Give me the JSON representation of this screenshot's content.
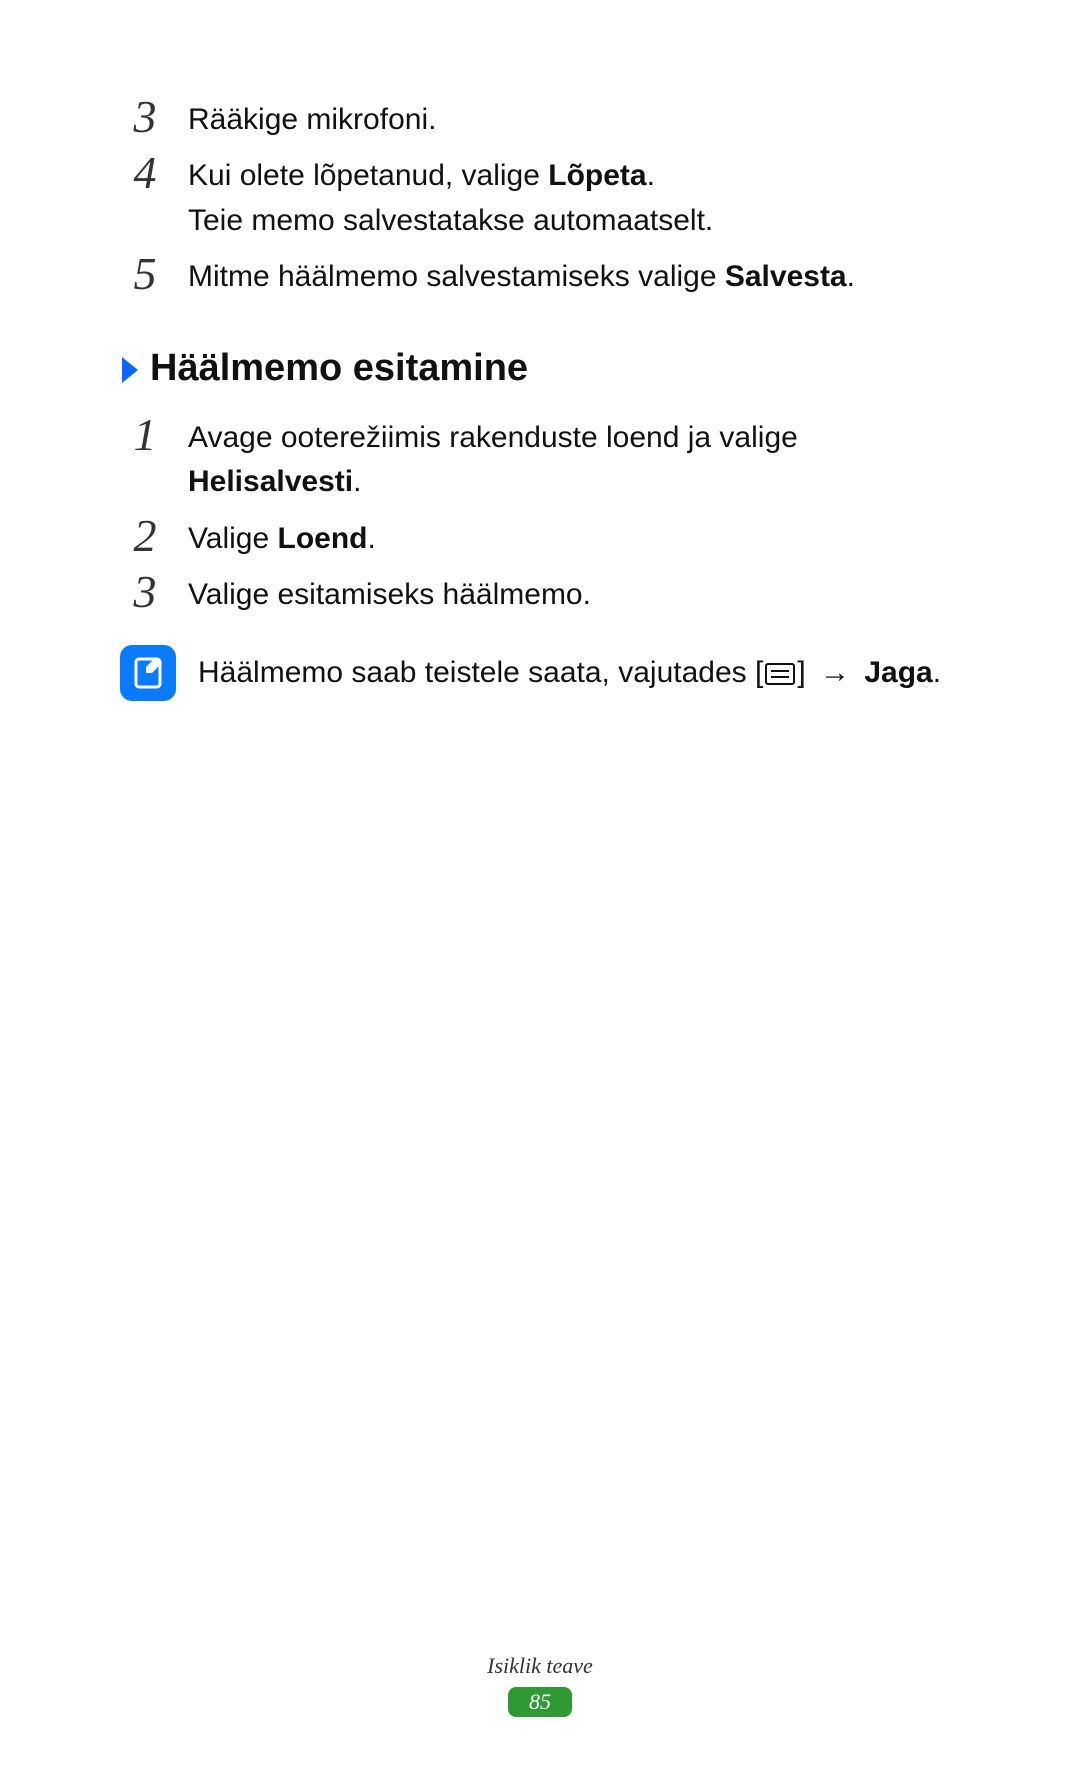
{
  "steps_a": [
    {
      "num": "3",
      "body": [
        {
          "text": "Rääkige mikrofoni."
        }
      ]
    },
    {
      "num": "4",
      "body": [
        {
          "text": "Kui olete lõpetanud, valige "
        },
        {
          "text": "Lõpeta",
          "bold": true
        },
        {
          "text": "."
        },
        {
          "break": true
        },
        {
          "text": "Teie memo salvestatakse automaatselt."
        }
      ]
    },
    {
      "num": "5",
      "body": [
        {
          "text": "Mitme häälmemo salvestamiseks valige "
        },
        {
          "text": "Salvesta",
          "bold": true
        },
        {
          "text": "."
        }
      ]
    }
  ],
  "section": {
    "title": "Häälmemo esitamine"
  },
  "steps_b": [
    {
      "num": "1",
      "body": [
        {
          "text": "Avage ooterežiimis rakenduste loend ja valige "
        },
        {
          "text": "Helisalvesti",
          "bold": true
        },
        {
          "text": "."
        }
      ]
    },
    {
      "num": "2",
      "body": [
        {
          "text": "Valige "
        },
        {
          "text": "Loend",
          "bold": true
        },
        {
          "text": "."
        }
      ]
    },
    {
      "num": "3",
      "body": [
        {
          "text": "Valige esitamiseks häälmemo."
        }
      ]
    }
  ],
  "note": {
    "parts": [
      {
        "text": "Häälmemo saab teistele saata, vajutades ["
      },
      {
        "icon": "menu"
      },
      {
        "text": "] "
      },
      {
        "arrow": "→"
      },
      {
        "text": " "
      },
      {
        "text": "Jaga",
        "bold": true
      },
      {
        "text": "."
      }
    ]
  },
  "footer": {
    "section_label": "Isiklik teave",
    "page_number": "85"
  }
}
